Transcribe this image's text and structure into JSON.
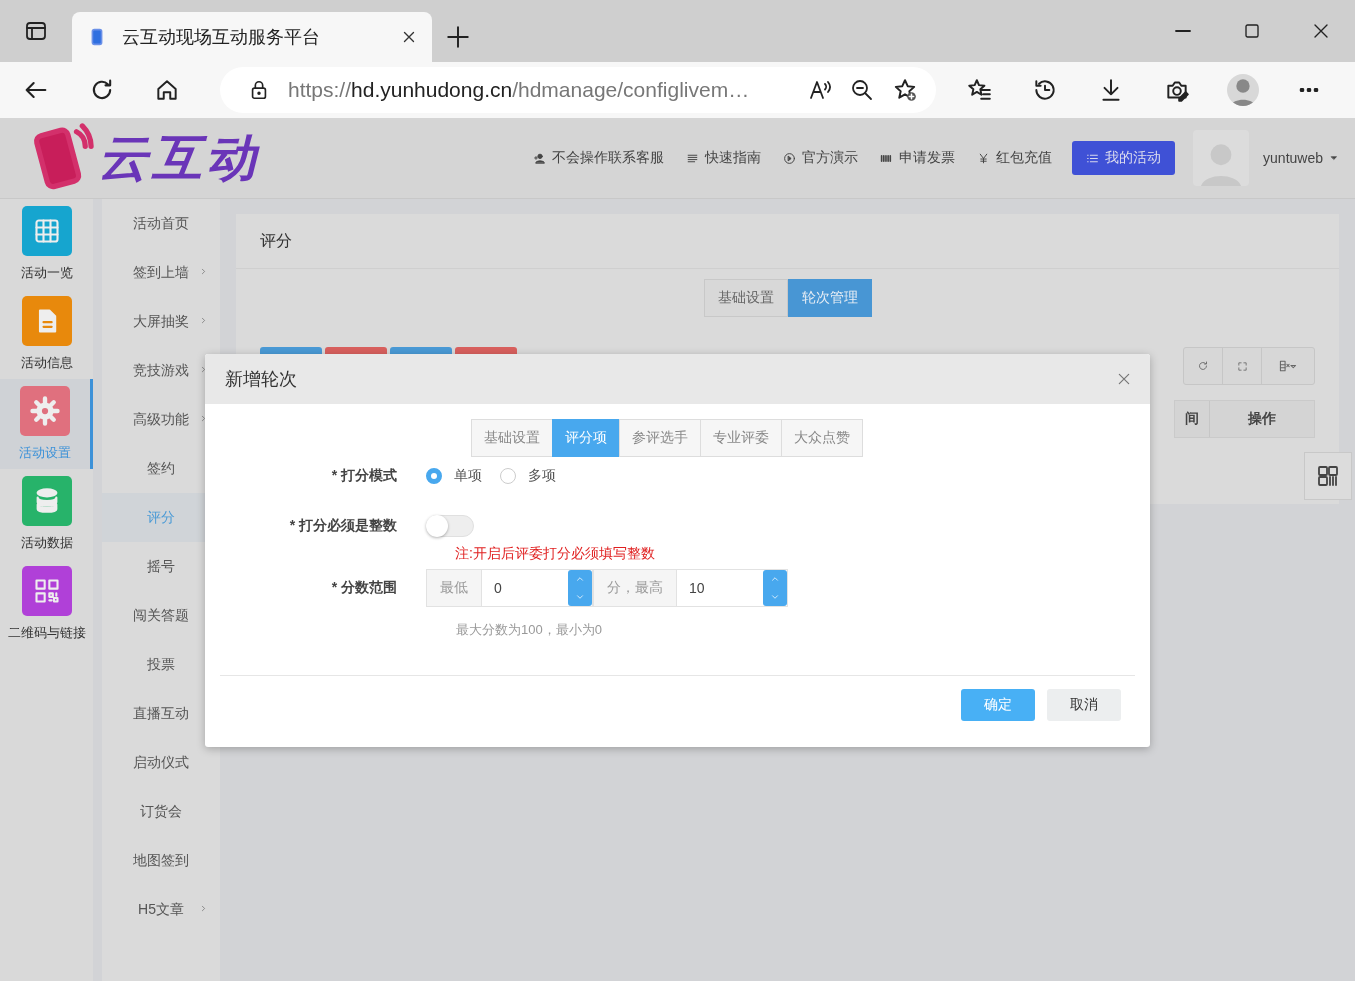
{
  "browser": {
    "tab_title": "云互动现场互动服务平台",
    "url_scheme": "https://",
    "url_host": "hd.yunhudong.cn",
    "url_path": "/hdmanage/configlivem…"
  },
  "header": {
    "logo_text": "云互动",
    "nav": [
      {
        "label": "不会操作联系客服",
        "kind": "user"
      },
      {
        "label": "快速指南",
        "kind": "lines"
      },
      {
        "label": "官方演示",
        "kind": "play"
      },
      {
        "label": "申请发票",
        "kind": "bars"
      },
      {
        "label": "红包充值",
        "kind": "yen"
      }
    ],
    "primary_button": "我的活动",
    "username": "yuntuweb"
  },
  "icon_sidebar": {
    "items": [
      {
        "label": "活动一览",
        "kind": "grid",
        "color": "#16a5cf",
        "selected": false
      },
      {
        "label": "活动信息",
        "kind": "doc",
        "color": "#e8890c",
        "selected": false
      },
      {
        "label": "活动设置",
        "kind": "gear",
        "color": "#e0707e",
        "selected": true
      },
      {
        "label": "活动数据",
        "kind": "db",
        "color": "#27b36a",
        "selected": false
      },
      {
        "label": "二维码与链接",
        "kind": "qr",
        "color": "#b040d8",
        "selected": false
      }
    ]
  },
  "submenu": {
    "items": [
      {
        "label": "活动首页",
        "expandable": false,
        "selected": false
      },
      {
        "label": "签到上墙",
        "expandable": true,
        "selected": false
      },
      {
        "label": "大屏抽奖",
        "expandable": true,
        "selected": false
      },
      {
        "label": "竞技游戏",
        "expandable": true,
        "selected": false
      },
      {
        "label": "高级功能",
        "expandable": true,
        "selected": false
      },
      {
        "label": "签约",
        "expandable": false,
        "selected": false
      },
      {
        "label": "评分",
        "expandable": false,
        "selected": true
      },
      {
        "label": "摇号",
        "expandable": false,
        "selected": false
      },
      {
        "label": "闯关答题",
        "expandable": false,
        "selected": false
      },
      {
        "label": "投票",
        "expandable": false,
        "selected": false
      },
      {
        "label": "直播互动",
        "expandable": false,
        "selected": false
      },
      {
        "label": "启动仪式",
        "expandable": false,
        "selected": false
      },
      {
        "label": "订货会",
        "expandable": false,
        "selected": false
      },
      {
        "label": "地图签到",
        "expandable": false,
        "selected": false
      },
      {
        "label": "H5文章",
        "expandable": true,
        "selected": false
      }
    ]
  },
  "content": {
    "title": "评分",
    "tabs": [
      {
        "label": "基础设置",
        "selected": false
      },
      {
        "label": "轮次管理",
        "selected": true
      }
    ],
    "action_buttons": [
      {
        "color": "#4a9ad6"
      },
      {
        "color": "#d9605e"
      },
      {
        "color": "#4a9ad6"
      },
      {
        "color": "#d9605e"
      }
    ],
    "table": {
      "columns": [
        "间",
        "操作"
      ]
    }
  },
  "modal": {
    "title": "新增轮次",
    "tabs": [
      {
        "label": "基础设置",
        "selected": false
      },
      {
        "label": "评分项",
        "selected": true
      },
      {
        "label": "参评选手",
        "selected": false
      },
      {
        "label": "专业评委",
        "selected": false
      },
      {
        "label": "大众点赞",
        "selected": false
      }
    ],
    "scoring_mode": {
      "label": "* 打分模式",
      "options": [
        {
          "label": "单项",
          "selected": true
        },
        {
          "label": "多项",
          "selected": false
        }
      ]
    },
    "integer_only": {
      "label": "* 打分必须是整数",
      "on": false,
      "note": "注:开启后评委打分必须填写整数"
    },
    "score_range": {
      "label": "* 分数范围",
      "min_prefix": "最低",
      "min_value": "0",
      "middle": "分，最高",
      "max_value": "10",
      "hint": "最大分数为100，最小为0"
    },
    "buttons": [
      {
        "label": "确定",
        "kind": "primary"
      },
      {
        "label": "取消",
        "kind": "default"
      }
    ]
  }
}
